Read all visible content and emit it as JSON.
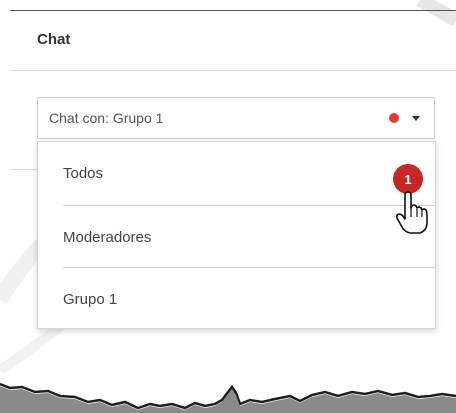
{
  "header": {
    "title": "Chat"
  },
  "chat_select": {
    "label": "Chat con: Grupo 1",
    "status_dot_color": "#e53935",
    "caret_icon": "chevron-down-icon"
  },
  "menu": {
    "items": [
      {
        "label": "Todos",
        "badge": "1"
      },
      {
        "label": "Moderadores"
      },
      {
        "label": "Grupo 1"
      }
    ]
  },
  "colors": {
    "badge": "#c62828",
    "border": "#cccccc",
    "text": "#444444"
  },
  "cursor_icon": "hand-pointer-icon"
}
